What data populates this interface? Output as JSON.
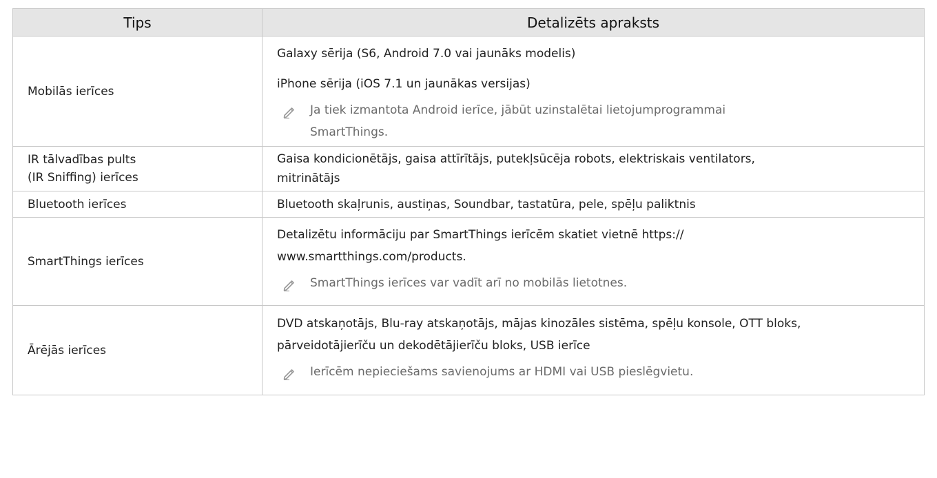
{
  "header": {
    "col1": "Tips",
    "col2": "Detalizēts apraksts"
  },
  "rows": [
    {
      "type": "Mobilās ierīces",
      "lines": [
        "Galaxy sērija (S6, Android 7.0 vai jaunāks modelis)",
        "iPhone sērija (iOS 7.1 un jaunākas versijas)"
      ],
      "note_lines": [
        "Ja tiek izmantota Android ierīce, jābūt uzinstalētai lietojumprogrammai",
        "SmartThings."
      ]
    },
    {
      "type_lines": [
        "IR tālvadības pults",
        "(IR Sniffing) ierīces"
      ],
      "lines": [
        "Gaisa kondicionētājs, gaisa attīrītājs, putekļsūcēja robots, elektriskais ventilators,",
        "mitrinātājs"
      ]
    },
    {
      "type": "Bluetooth ierīces",
      "lines": [
        "Bluetooth skaļrunis, austiņas, Soundbar, tastatūra, pele, spēļu paliktnis"
      ]
    },
    {
      "type": "SmartThings ierīces",
      "lines": [
        "Detalizētu informāciju par SmartThings ierīcēm skatiet vietnē https://",
        "www.smartthings.com/products."
      ],
      "note_lines": [
        "SmartThings ierīces var vadīt arī no mobilās lietotnes."
      ]
    },
    {
      "type": "Ārējās ierīces",
      "lines": [
        "DVD atskaņotājs, Blu-ray atskaņotājs, mājas kinozāles sistēma, spēļu konsole, OTT bloks,",
        "pārveidotājierīču un dekodētājierīču bloks, USB ierīce"
      ],
      "note_lines": [
        "Ierīcēm nepieciešams savienojums ar HDMI vai USB pieslēgvietu."
      ]
    }
  ],
  "icons": {
    "note": "pencil-note-icon"
  },
  "colors": {
    "header_bg": "#e5e5e5",
    "border": "#c8c8c8",
    "note_text": "#6b6b6b"
  }
}
